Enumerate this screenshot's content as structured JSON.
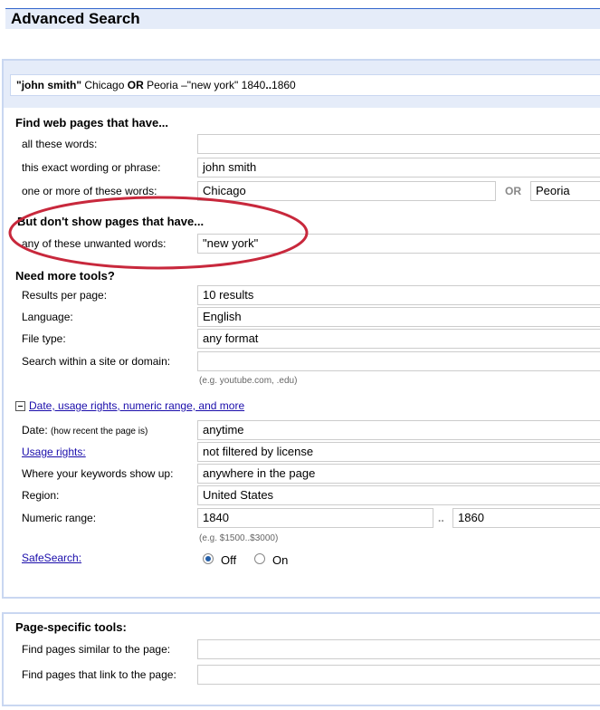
{
  "header": {
    "title": "Advanced Search"
  },
  "query": {
    "part1": "\"john smith\"",
    "part2": " Chicago ",
    "or_word": "OR",
    "part3": " Peoria –\"new york\" 1840",
    "range_dots": "..",
    "part4": "1860"
  },
  "find": {
    "heading": "Find web pages that have...",
    "all_words_label": "all these words:",
    "all_words_value": "",
    "exact_label": "this exact wording or phrase:",
    "exact_value": "john smith",
    "any_label": "one or more of these words:",
    "any_value_1": "Chicago",
    "or_label": "OR",
    "any_value_2": "Peoria"
  },
  "exclude": {
    "heading": "But don't show pages that have...",
    "unwanted_label": "any of these unwanted words:",
    "unwanted_value": "\"new york\""
  },
  "tools": {
    "heading": "Need more tools?",
    "results_label": "Results per page:",
    "results_value": "10 results",
    "language_label": "Language:",
    "language_value": "English",
    "filetype_label": "File type:",
    "filetype_value": "any format",
    "site_label": "Search within a site or domain:",
    "site_value": "",
    "site_hint": "(e.g. youtube.com, .edu)"
  },
  "more": {
    "toggle_label": "Date, usage rights, numeric range, and more",
    "date_label": "Date:",
    "date_sub": "(how recent the page is)",
    "date_value": "anytime",
    "usage_label": "Usage rights:",
    "usage_value": "not filtered by license",
    "where_label": "Where your keywords show up:",
    "where_value": "anywhere in the page",
    "region_label": "Region:",
    "region_value": "United States",
    "numeric_label": "Numeric range:",
    "numeric_from": "1840",
    "numeric_dots": "..",
    "numeric_to": "1860",
    "numeric_hint": "(e.g. $1500..$3000)",
    "safesearch_label": "SafeSearch:",
    "safe_off": "Off",
    "safe_on": "On"
  },
  "page_tools": {
    "heading": "Page-specific tools:",
    "similar_label": "Find pages similar to the page:",
    "similar_value": "",
    "link_label": "Find pages that link to the page:",
    "link_value": ""
  },
  "colors": {
    "accent": "#3366cc",
    "band": "#e5ecf9",
    "link": "#1a0dab",
    "annotation": "#c8283c"
  }
}
